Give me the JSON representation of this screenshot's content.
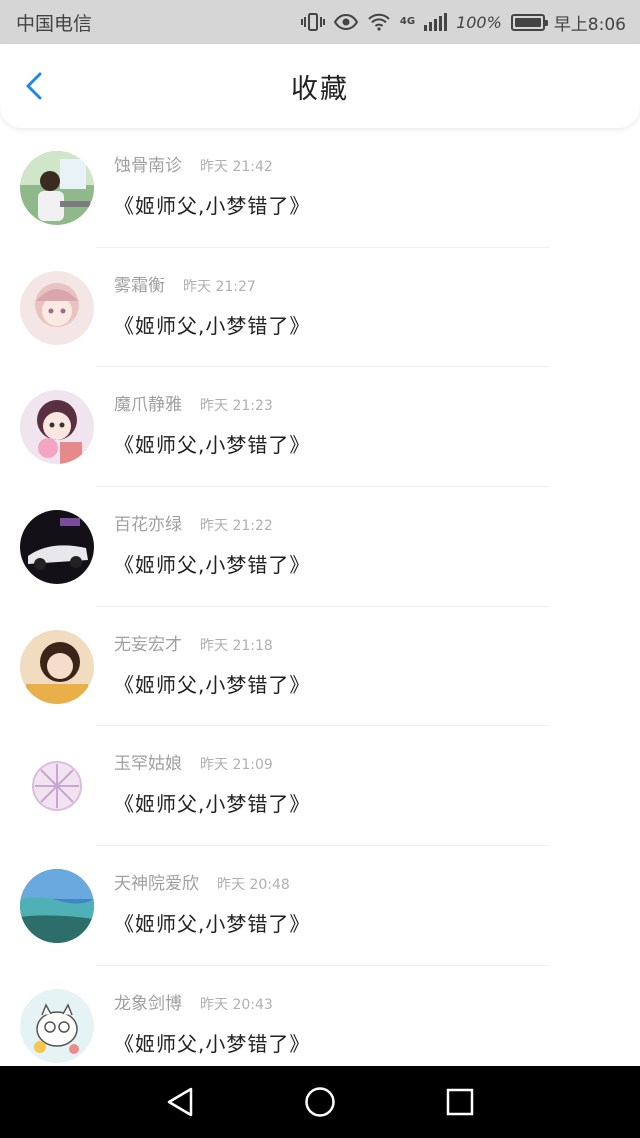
{
  "status_bar": {
    "carrier": "中国电信",
    "network": "4G",
    "battery": "100%",
    "time": "早上8:06"
  },
  "header": {
    "title": "收藏",
    "back_icon": "chevron-left-icon",
    "accent_color": "#1e88e5"
  },
  "favorites": [
    {
      "user": "蚀骨南诊",
      "day": "昨天",
      "time": "21:42",
      "message": "《姬师父,小梦错了》"
    },
    {
      "user": "雾霜衡",
      "day": "昨天",
      "time": "21:27",
      "message": "《姬师父,小梦错了》"
    },
    {
      "user": "魔爪静雅",
      "day": "昨天",
      "time": "21:23",
      "message": "《姬师父,小梦错了》"
    },
    {
      "user": "百花亦绿",
      "day": "昨天",
      "time": "21:22",
      "message": "《姬师父,小梦错了》"
    },
    {
      "user": "无妄宏才",
      "day": "昨天",
      "time": "21:18",
      "message": "《姬师父,小梦错了》"
    },
    {
      "user": "玉罕姑娘",
      "day": "昨天",
      "time": "21:09",
      "message": "《姬师父,小梦错了》"
    },
    {
      "user": "天神院爱欣",
      "day": "昨天",
      "time": "20:48",
      "message": "《姬师父,小梦错了》"
    },
    {
      "user": "龙象剑博",
      "day": "昨天",
      "time": "20:43",
      "message": "《姬师父,小梦错了》"
    }
  ],
  "nav": {
    "back_icon": "triangle-back-icon",
    "home_icon": "circle-home-icon",
    "recent_icon": "square-recents-icon"
  }
}
